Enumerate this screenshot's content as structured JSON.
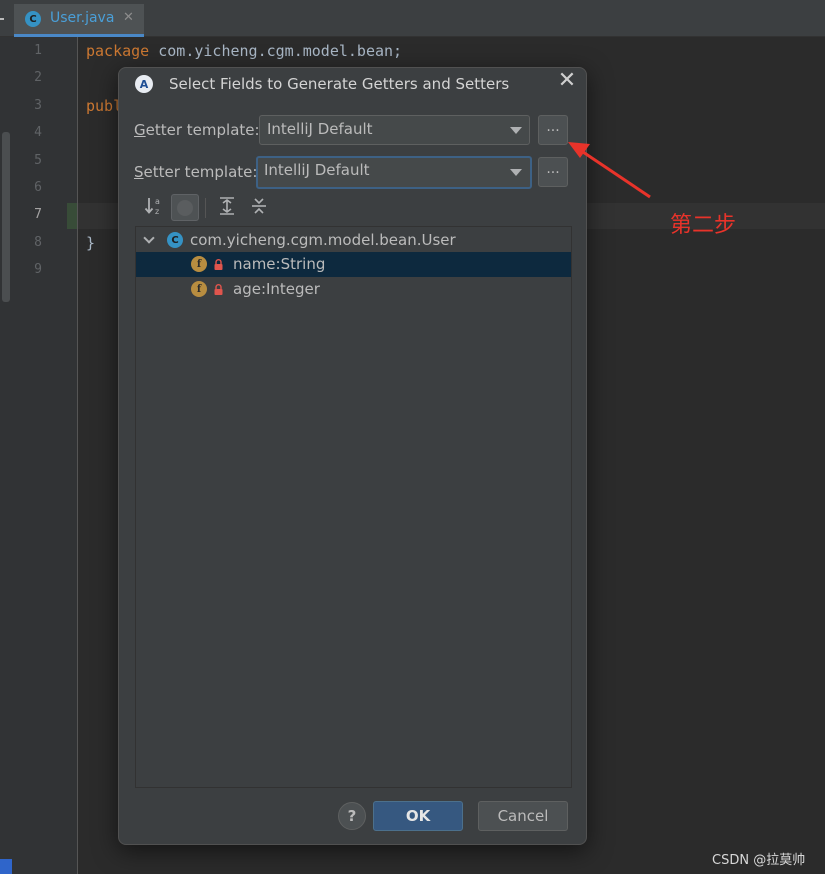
{
  "editor": {
    "tab": {
      "label": "User.java",
      "close_glyph": "✕",
      "icon": "java-class-icon",
      "icon_letter": "C"
    },
    "line_numbers": [
      "1",
      "2",
      "3",
      "4",
      "5",
      "6",
      "7",
      "8",
      "9"
    ],
    "current_line": "7",
    "code": {
      "line1_keyword": "package",
      "line1_rest": " com.yicheng.cgm.model.bean;",
      "line3_keyword": "publ",
      "line8_text": "}"
    }
  },
  "dialog": {
    "title": "Select Fields to Generate Getters and Setters",
    "logo_letter": "A",
    "close_glyph": "✕",
    "getter": {
      "label_mnemonic": "G",
      "label_rest": "etter template:",
      "value": "IntelliJ Default",
      "browse_label": "..."
    },
    "setter": {
      "label_mnemonic": "S",
      "label_rest": "etter template:",
      "value": "IntelliJ Default",
      "browse_label": "..."
    },
    "toolbar": {
      "icons": [
        "sort-alphabetically-icon",
        "show-classes-icon",
        "expand-all-icon",
        "collapse-all-icon"
      ],
      "sort_sup": "a",
      "sort_sub": "z"
    },
    "tree": {
      "root": {
        "label": "com.yicheng.cgm.model.bean.User",
        "icon": "class-icon",
        "icon_letter": "C"
      },
      "fields": [
        {
          "label": "name:String",
          "icon": "field-icon",
          "icon_letter": "f",
          "selected": true
        },
        {
          "label": "age:Integer",
          "icon": "field-icon",
          "icon_letter": "f",
          "selected": false
        }
      ]
    },
    "buttons": {
      "help": "?",
      "ok": "OK",
      "cancel": "Cancel"
    }
  },
  "annotation": {
    "text": "第二步",
    "color": "#e8332a"
  },
  "watermark": "CSDN @拉莫帅",
  "colors": {
    "accent": "#4a88c7",
    "selection": "#0d293e",
    "ok_button": "#365880",
    "keyword": "#cc7832"
  }
}
